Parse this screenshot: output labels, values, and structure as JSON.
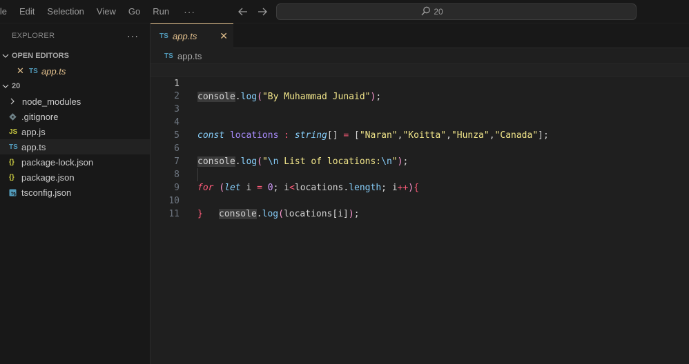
{
  "menu": {
    "items": [
      "ile",
      "Edit",
      "Selection",
      "View",
      "Go",
      "Run"
    ],
    "more": "···"
  },
  "command_center": {
    "text": "20"
  },
  "explorer": {
    "title": "EXPLORER",
    "more": "···",
    "open_editors": {
      "label": "OPEN EDITORS",
      "items": [
        {
          "icon": "TS",
          "name": "app.ts"
        }
      ]
    },
    "folder": {
      "label": "20",
      "items": [
        {
          "type": "folder",
          "name": "node_modules"
        },
        {
          "type": "gitignore",
          "name": ".gitignore"
        },
        {
          "type": "js",
          "icon": "JS",
          "name": "app.js"
        },
        {
          "type": "ts",
          "icon": "TS",
          "name": "app.ts"
        },
        {
          "type": "json",
          "icon": "{}",
          "name": "package-lock.json"
        },
        {
          "type": "json",
          "icon": "{}",
          "name": "package.json"
        },
        {
          "type": "tsconfig",
          "name": "tsconfig.json"
        }
      ]
    }
  },
  "editor": {
    "tab": {
      "icon": "TS",
      "label": "app.ts"
    },
    "breadcrumb": {
      "icon": "TS",
      "label": "app.ts"
    },
    "line_numbers": [
      "1",
      "2",
      "3",
      "4",
      "5",
      "6",
      "7",
      "8",
      "9",
      "10",
      "11"
    ],
    "code": {
      "l1": {
        "obj": "console",
        "dot": ".",
        "fn": "log",
        "p1": "(",
        "str": "\"By Muhammad Junaid\"",
        "p2": ")",
        "end": ";"
      },
      "l4": {
        "kw": "const",
        "var": "locations",
        "colon": ":",
        "type": "string",
        "brackets": "[]",
        "eq": "=",
        "open": "[",
        "s1": "\"Naran\"",
        "s2": "\"Koitta\"",
        "s3": "\"Hunza\"",
        "s4": "\"Canada\"",
        "close": "]",
        "end": ";",
        "comma": ","
      },
      "l6": {
        "obj": "console",
        "dot": ".",
        "fn": "log",
        "p1": "(",
        "q1": "\"",
        "esc1": "\\n",
        "mid": " List of locations:",
        "esc2": "\\n",
        "q2": "\"",
        "p2": ")",
        "end": ";"
      },
      "l8": {
        "kw": "for",
        "p1": "(",
        "let": "let",
        "i": "i",
        "eq": "=",
        "zero": "0",
        "semi": ";",
        "i2": "i",
        "lt": "<",
        "loc": "locations",
        "dot": ".",
        "len": "length",
        "i3": "i",
        "inc": "++",
        "p2": ")",
        "brace": "{"
      },
      "l9": {
        "obj": "console",
        "dot": ".",
        "fn": "log",
        "p1": "(",
        "arg": "locations[i]",
        "p2": ")",
        "end": ";"
      },
      "l10": {
        "brace": "}"
      }
    }
  }
}
